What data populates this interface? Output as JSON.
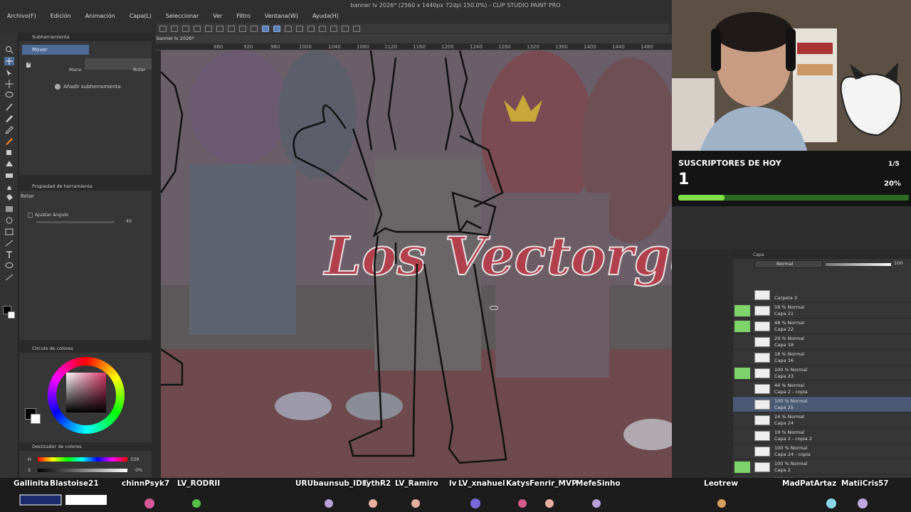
{
  "window": {
    "title": "banner lv 2026* (2560 x 1440px 72dpi 150.0%) - CLIP STUDIO PAINT PRO",
    "menu": [
      "Archivo(F)",
      "Edición",
      "Animación",
      "Capa(L)",
      "Seleccionar",
      "Ver",
      "Filtro",
      "Ventana(W)",
      "Ayuda(H)"
    ]
  },
  "subtool": {
    "tab_label": "Subherramienta",
    "selected": "Mover",
    "hand_label": "Mano",
    "rotate_label": "Rotar",
    "add_label": "Añadir subherramienta"
  },
  "tool_property": {
    "tab_label": "Propiedad de herramienta",
    "tool_name": "Rotar",
    "option_label": "Ajustar ángulo",
    "angle_value": "45"
  },
  "color": {
    "circle_label": "Círculo de colores",
    "slider_label": "Deslizador de colores",
    "h_label": "H",
    "h_value": "339",
    "s_label": "S",
    "s_value": "0%",
    "main_color": "#000000",
    "sub_color": "#ffffff"
  },
  "canvas": {
    "doc_tab": "banner lv 2026*",
    "ruler": [
      "880",
      "920",
      "960",
      "1000",
      "1040",
      "1080",
      "1120",
      "1160",
      "1200",
      "1240",
      "1280",
      "1320",
      "1360",
      "1400",
      "1440",
      "1480"
    ],
    "art_text": "Los Vectorgas"
  },
  "overlay": {
    "title": "SUSCRIPTORES DE HOY",
    "count": "1",
    "goal": "1/5",
    "percent_label": "20%",
    "progress": 0.2,
    "accent": "#7fe04a"
  },
  "layers": {
    "tab_label": "Capa",
    "blend_mode": "Normal",
    "opacity": "100",
    "rows": [
      {
        "l1": "",
        "l2": "Carpeta 3",
        "eye": false
      },
      {
        "l1": "58 % Normal",
        "l2": "Capa 21",
        "eye": true
      },
      {
        "l1": "48 % Normal",
        "l2": "Capa 22",
        "eye": true
      },
      {
        "l1": "29 % Normal",
        "l2": "Capa 18",
        "eye": false
      },
      {
        "l1": "18 % Normal",
        "l2": "Capa 16",
        "eye": false
      },
      {
        "l1": "100 % Normal",
        "l2": "Capa 23",
        "eye": true
      },
      {
        "l1": "44 % Normal",
        "l2": "Capa 2 - copia",
        "eye": false
      },
      {
        "l1": "100 % Normal",
        "l2": "Capa 25",
        "eye": false,
        "selected": true
      },
      {
        "l1": "24 % Normal",
        "l2": "Capa 24",
        "eye": false
      },
      {
        "l1": "19 % Normal",
        "l2": "Capa 2 - copia 2",
        "eye": false
      },
      {
        "l1": "100 % Normal",
        "l2": "Capa 24 - copia",
        "eye": false
      },
      {
        "l1": "100 % Normal",
        "l2": "Capa 2",
        "eye": true
      },
      {
        "l1": "100 % Normal",
        "l2": "Capa 9 - copia",
        "eye": false
      }
    ]
  },
  "chat_names": [
    "Gallinita",
    "Blastoise21",
    "chinnPsyk",
    "7",
    "LV_RODRII",
    "URUbaunsub_IDK",
    "lythR2",
    "LV_Ramiro",
    "lv",
    "LV_xnahuel",
    "Katys",
    "Fenrir_MVP",
    "MefeSinho",
    "Leotrew",
    "MadPatArt",
    "az",
    "MatiiCris",
    "57"
  ]
}
